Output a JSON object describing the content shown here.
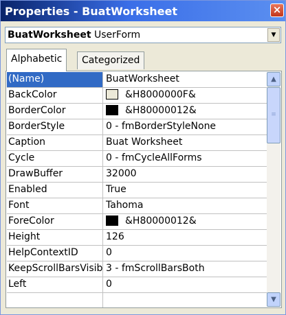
{
  "window": {
    "title": "Properties - BuatWorksheet",
    "close_glyph": "×"
  },
  "object_selector": {
    "object_name": "BuatWorksheet",
    "object_type": "UserForm",
    "dropdown_glyph": "▼"
  },
  "tabs": [
    {
      "label": "Alphabetic",
      "active": true
    },
    {
      "label": "Categorized",
      "active": false
    }
  ],
  "properties": [
    {
      "name": "(Name)",
      "value": "BuatWorksheet",
      "selected": true
    },
    {
      "name": "BackColor",
      "value": "&H8000000F&",
      "swatch": "#ece9d8"
    },
    {
      "name": "BorderColor",
      "value": "&H80000012&",
      "swatch": "#000000"
    },
    {
      "name": "BorderStyle",
      "value": "0 - fmBorderStyleNone"
    },
    {
      "name": "Caption",
      "value": "Buat Worksheet"
    },
    {
      "name": "Cycle",
      "value": "0 - fmCycleAllForms"
    },
    {
      "name": "DrawBuffer",
      "value": "32000"
    },
    {
      "name": "Enabled",
      "value": "True"
    },
    {
      "name": "Font",
      "value": "Tahoma"
    },
    {
      "name": "ForeColor",
      "value": "&H80000012&",
      "swatch": "#000000"
    },
    {
      "name": "Height",
      "value": "126"
    },
    {
      "name": "HelpContextID",
      "value": "0"
    },
    {
      "name": "KeepScrollBarsVisible",
      "value": "3 - fmScrollBarsBoth"
    },
    {
      "name": "Left",
      "value": "0"
    },
    {
      "name": "",
      "value": ""
    }
  ],
  "scrollbar": {
    "up_glyph": "▲",
    "down_glyph": "▼",
    "grip_glyph": "≡"
  },
  "colors": {
    "selection": "#316ac5",
    "title_start": "#0a246a",
    "title_end": "#5b8ff0"
  }
}
